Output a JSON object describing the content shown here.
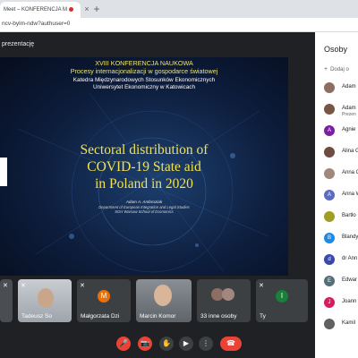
{
  "browser": {
    "tab_title": "Meet – KONFERENCJA M",
    "close_glyph": "×",
    "new_tab_glyph": "+",
    "url": "ncv-bylm-ndw?authuser=0"
  },
  "meet": {
    "presenting_banner": "prezentację"
  },
  "slide": {
    "conference": "XVIII KONFERENCJA NAUKOWA",
    "subtitle": "Procesy internacjonalizacji w gospodarce światowej",
    "department": "Katedra Międzynarodowych Stosunków Ekonomicznych",
    "university": "Uniwersytet Ekonomiczny w Katowicach",
    "title_line1": "Sectoral distribution of",
    "title_line2": "COVID-19 State aid",
    "title_line3": "in Poland in 2020",
    "author": "Adam A. Ambroziak",
    "affiliation_line1": "Department  of  European Integration and Legal Studies",
    "affiliation_line2": "SGH Warsaw School of Economics"
  },
  "tiles": [
    {
      "name": "",
      "type": "video"
    },
    {
      "name": "Tadeusz So",
      "type": "video"
    },
    {
      "name": "Małgorzata Dzi",
      "type": "avatar",
      "initial": "M",
      "color": "#e8710a"
    },
    {
      "name": "Marcin Komor",
      "type": "video"
    },
    {
      "name": "33 inne osoby",
      "type": "group"
    },
    {
      "name": "Ty",
      "type": "avatar",
      "initial": "I",
      "color": "#188038"
    }
  ],
  "controls": {
    "mic_off": "🎤",
    "cam_off": "📷",
    "hand": "✋",
    "present": "▶",
    "more": "⋮",
    "leave": "☎"
  },
  "panel": {
    "title": "Osoby",
    "add_label": "Dodaj o",
    "participants": [
      {
        "name": "Adam",
        "sub": "",
        "initial": "A",
        "color": "#8d6e63",
        "photo": true
      },
      {
        "name": "Adam",
        "sub": "Prezen",
        "initial": "A",
        "color": "#795548",
        "photo": true
      },
      {
        "name": "Agnie",
        "sub": "",
        "initial": "A",
        "color": "#7b1fa2",
        "photo": false
      },
      {
        "name": "Alina G",
        "sub": "",
        "initial": "A",
        "color": "#6d4c41",
        "photo": true
      },
      {
        "name": "Anna G",
        "sub": "",
        "initial": "A",
        "color": "#a1887f",
        "photo": true
      },
      {
        "name": "Anna W",
        "sub": "",
        "initial": "A",
        "color": "#5c6bc0",
        "photo": false
      },
      {
        "name": "Bartło",
        "sub": "",
        "initial": "B",
        "color": "#9e9d24",
        "photo": true
      },
      {
        "name": "Blandy",
        "sub": "",
        "initial": "B",
        "color": "#1e88e5",
        "photo": false
      },
      {
        "name": "dr Ann",
        "sub": "",
        "initial": "d",
        "color": "#3949ab",
        "photo": false
      },
      {
        "name": "Edwar",
        "sub": "",
        "initial": "E",
        "color": "#546e7a",
        "photo": false
      },
      {
        "name": "Joann",
        "sub": "",
        "initial": "J",
        "color": "#d81b60",
        "photo": false
      },
      {
        "name": "Kamil",
        "sub": "",
        "initial": "K",
        "color": "#616161",
        "photo": true
      }
    ]
  }
}
